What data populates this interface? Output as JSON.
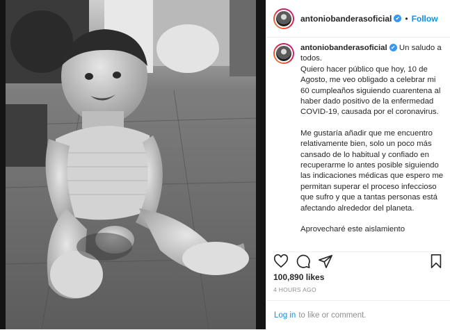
{
  "post": {
    "username": "antoniobanderasoficial",
    "verified_mark": "✔",
    "separator": "•",
    "follow_label": "Follow",
    "caption_greeting": "Un saludo a todos.",
    "caption_paragraph_1": "Quiero hacer público que hoy, 10 de Agosto, me veo obligado a celebrar mi 60 cumpleaños siguiendo cuarentena al haber dado positivo de la enfermedad COVID-19, causada por el coronavirus.",
    "caption_paragraph_2": "Me gustaría añadir que me encuentro relativamente bien, solo un poco más cansado de lo habitual y confiado en recuperarme lo antes posible siguiendo las indicaciones médicas que espero me permitan superar el proceso infeccioso que sufro y que a tantas personas está afectando alrededor del planeta.",
    "caption_paragraph_3": "Aprovecharé este aislamiento",
    "likes": "100,890 likes",
    "time_ago": "4 HOURS AGO",
    "login_label": "Log in",
    "comment_prompt": "to like or comment."
  },
  "icons": {
    "like": "heart-icon",
    "comment": "comment-icon",
    "share": "share-icon",
    "save": "bookmark-icon"
  },
  "colors": {
    "accent": "#0095f6",
    "verified": "#3897f0",
    "muted": "#8e8e8e",
    "text": "#262626"
  }
}
